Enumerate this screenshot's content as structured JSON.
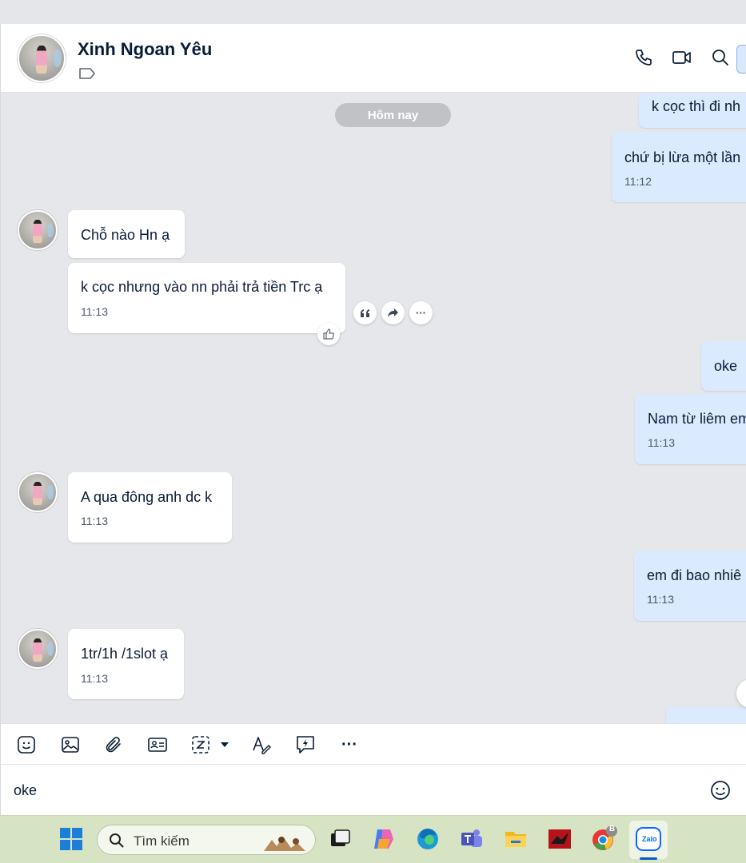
{
  "header": {
    "contact_name": "Xinh Ngoan Yêu",
    "icons": [
      "phone-icon",
      "video-call-icon",
      "search-icon",
      "label-tag-icon"
    ]
  },
  "chat": {
    "date_divider": "Hôm nay",
    "messages": [
      {
        "side": "out",
        "text": "k cọc thì đi nh",
        "time": ""
      },
      {
        "side": "out",
        "text": "chứ bị lừa một lần",
        "time": "11:12"
      },
      {
        "side": "in",
        "text": "Chỗ nào Hn ạ",
        "time": ""
      },
      {
        "side": "in",
        "text": "k cọc nhưng vào nn phải trả tiền Trc ạ",
        "time": "11:13"
      },
      {
        "side": "out",
        "text": "oke",
        "time": ""
      },
      {
        "side": "out",
        "text": "Nam từ liêm em",
        "time": "11:13"
      },
      {
        "side": "in",
        "text": "A qua đông anh dc k",
        "time": "11:13"
      },
      {
        "side": "out",
        "text": "em đi bao nhiê",
        "time": "11:13"
      },
      {
        "side": "in",
        "text": "1tr/1h /1slot ạ",
        "time": "11:13"
      }
    ],
    "hover_actions": [
      "quote-icon",
      "forward-icon",
      "more-icon"
    ],
    "hover_more_label": "···"
  },
  "toolbar": {
    "icons": [
      "sticker-icon",
      "image-icon",
      "attachment-icon",
      "contact-card-icon",
      "screenshot-icon",
      "text-format-icon",
      "quick-message-icon",
      "more-icon"
    ],
    "more_label": "···"
  },
  "composer": {
    "value": "oke"
  },
  "taskbar": {
    "search_placeholder": "Tìm kiếm",
    "chrome_badge": "B",
    "zalo_label": "Zalo"
  },
  "colors": {
    "outgoing_bubble": "#dbebff",
    "incoming_bubble": "#ffffff",
    "chat_background": "#e6e7ea",
    "divider_pill": "#c0c2c6",
    "taskbar": "#d6e4c3"
  }
}
